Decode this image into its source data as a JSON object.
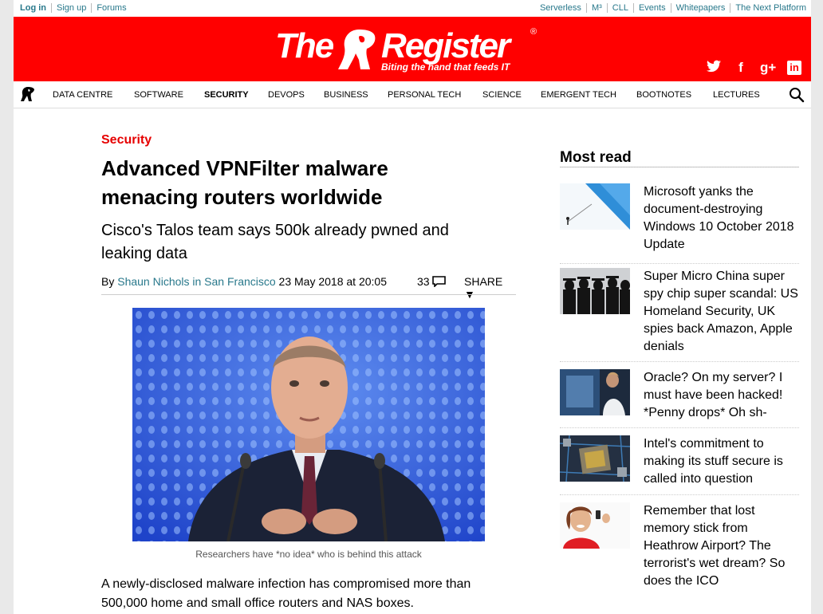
{
  "topbar": {
    "left": [
      "Log in",
      "Sign up",
      "Forums"
    ],
    "right": [
      "Serverless",
      "M³",
      "CLL",
      "Events",
      "Whitepapers",
      "The Next Platform"
    ]
  },
  "masthead": {
    "logo_word1": "The",
    "logo_word2": "Register",
    "logo_reg": "®",
    "tagline": "Biting the hand that feeds IT",
    "social_icons": [
      "twitter-icon",
      "facebook-icon",
      "google-plus-icon",
      "linkedin-icon"
    ],
    "social_glyphs": [
      "🐦",
      "f",
      "g+",
      "in"
    ]
  },
  "nav": {
    "items": [
      "DATA CENTRE",
      "SOFTWARE",
      "SECURITY",
      "DEVOPS",
      "BUSINESS",
      "PERSONAL TECH",
      "SCIENCE",
      "EMERGENT TECH",
      "BOOTNOTES",
      "LECTURES"
    ],
    "active": "SECURITY"
  },
  "article": {
    "section": "Security",
    "headline": "Advanced VPNFilter malware menacing routers worldwide",
    "standfirst": "Cisco's Talos team says 500k already pwned and leaking data",
    "by": "By ",
    "author": "Shaun Nichols in San Francisco",
    "date": " 23 May 2018 at 20:05",
    "comments": "33",
    "share": "SHARE ▼",
    "caption": "Researchers have *no idea* who is behind this attack",
    "body": "A newly-disclosed malware infection has compromised more than 500,000 home and small office routers and NAS boxes."
  },
  "most_read": {
    "title": "Most read",
    "items": [
      "Microsoft yanks the document-destroying Windows 10 October 2018 Update",
      "Super Micro China super spy chip super scandal: US Homeland Security, UK spies back Amazon, Apple denials",
      "Oracle? On my server? I must have been hacked! *Penny drops* Oh sh-",
      "Intel's commitment to making its stuff secure is called into question",
      "Remember that lost memory stick from Heathrow Airport? The terrorist's wet dream? So does the ICO"
    ]
  },
  "colors": {
    "brand_red": "#ff0000",
    "link_teal": "#28788b",
    "section_red": "#e60000"
  }
}
